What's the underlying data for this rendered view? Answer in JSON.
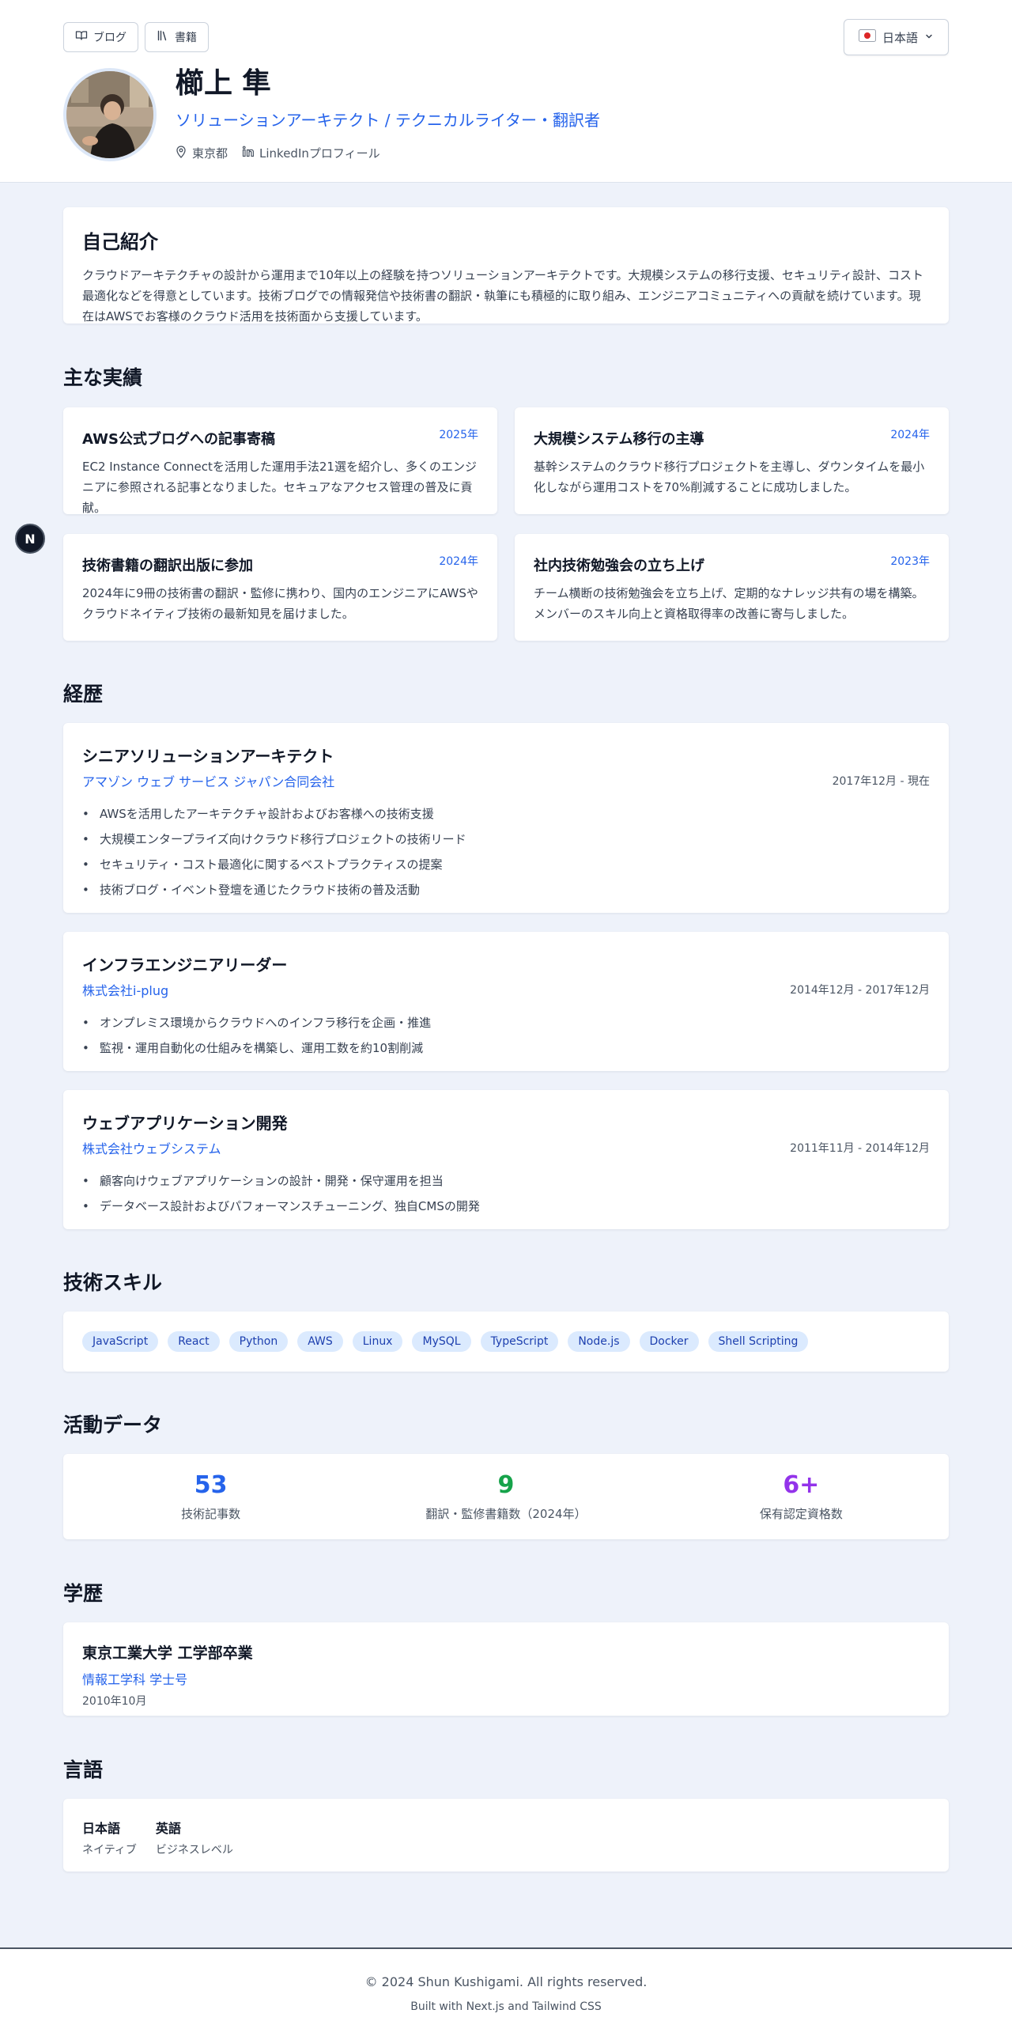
{
  "header": {
    "btn_blog": "ブログ",
    "btn_books": "書籍",
    "lang_select": "日本語",
    "name": "櫛上 隼",
    "title": "ソリューションアーキテクト / テクニカルライター・翻訳者",
    "location": "東京都",
    "linkedin": "LinkedInプロフィール"
  },
  "summary": {
    "heading": "自己紹介",
    "text": "クラウドアーキテクチャの設計から運用まで10年以上の経験を持つソリューションアーキテクトです。大規模システムの移行支援、セキュリティ設計、コスト最適化などを得意としています。技術ブログでの情報発信や技術書の翻訳・執筆にも積極的に取り組み、エンジニアコミュニティへの貢献を続けています。現在はAWSでお客様のクラウド活用を技術面から支援しています。"
  },
  "achievements": {
    "heading": "主な実績",
    "items": [
      {
        "title": "AWS公式ブログへの記事寄稿",
        "year": "2025年",
        "desc": "EC2 Instance Connectを活用した運用手法21選を紹介し、多くのエンジニアに参照される記事となりました。セキュアなアクセス管理の普及に貢献。"
      },
      {
        "title": "大規模システム移行の主導",
        "year": "2024年",
        "desc": "基幹システムのクラウド移行プロジェクトを主導し、ダウンタイムを最小化しながら運用コストを70%削減することに成功しました。"
      },
      {
        "title": "技術書籍の翻訳出版に参加",
        "year": "2024年",
        "desc": "2024年に9冊の技術書の翻訳・監修に携わり、国内のエンジニアにAWSやクラウドネイティブ技術の最新知見を届けました。"
      },
      {
        "title": "社内技術勉強会の立ち上げ",
        "year": "2023年",
        "desc": "チーム横断の技術勉強会を立ち上げ、定期的なナレッジ共有の場を構築。メンバーのスキル向上と資格取得率の改善に寄与しました。"
      }
    ]
  },
  "experience": {
    "heading": "経歴",
    "items": [
      {
        "title": "シニアソリューションアーキテクト",
        "company": "アマゾン ウェブ サービス ジャパン合同会社",
        "period": "2017年12月 - 現在",
        "bullets": [
          "AWSを活用したアーキテクチャ設計およびお客様への技術支援",
          "大規模エンタープライズ向けクラウド移行プロジェクトの技術リード",
          "セキュリティ・コスト最適化に関するベストプラクティスの提案",
          "技術ブログ・イベント登壇を通じたクラウド技術の普及活動"
        ]
      },
      {
        "title": "インフラエンジニアリーダー",
        "company": "株式会社i-plug",
        "period": "2014年12月 - 2017年12月",
        "bullets": [
          "オンプレミス環境からクラウドへのインフラ移行を企画・推進",
          "監視・運用自動化の仕組みを構築し、運用工数を約10割削減"
        ]
      },
      {
        "title": "ウェブアプリケーション開発",
        "company": "株式会社ウェブシステム",
        "period": "2011年11月 - 2014年12月",
        "bullets": [
          "顧客向けウェブアプリケーションの設計・開発・保守運用を担当",
          "データベース設計およびパフォーマンスチューニング、独自CMSの開発"
        ]
      }
    ]
  },
  "skills": {
    "heading": "技術スキル",
    "items": [
      "JavaScript",
      "React",
      "Python",
      "AWS",
      "Linux",
      "MySQL",
      "TypeScript",
      "Node.js",
      "Docker",
      "Shell Scripting"
    ]
  },
  "stats": {
    "heading": "活動データ",
    "items": [
      {
        "value": "53",
        "label": "技術記事数",
        "color": "#2563eb"
      },
      {
        "value": "9",
        "label": "翻訳・監修書籍数（2024年）",
        "color": "#16a34a"
      },
      {
        "value": "6+",
        "label": "保有認定資格数",
        "color": "#9333ea"
      }
    ]
  },
  "education": {
    "heading": "学歴",
    "school": "東京工業大学 工学部卒業",
    "degree": "情報工学科 学士号",
    "date": "2010年10月"
  },
  "languages": {
    "heading": "言語",
    "items": [
      {
        "name": "日本語",
        "level": "ネイティブ"
      },
      {
        "name": "英語",
        "level": "ビジネスレベル"
      }
    ]
  },
  "footer": {
    "copyright": "© 2024 Shun Kushigami. All rights reserved.",
    "built": "Built with Next.js and Tailwind CSS"
  },
  "fab_label": "N"
}
